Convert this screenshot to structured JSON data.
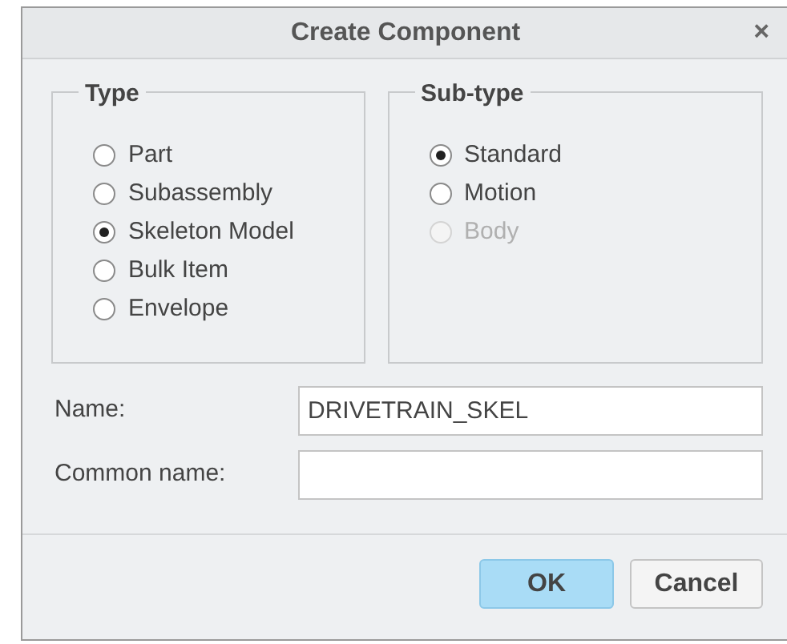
{
  "window": {
    "title": "Create Component",
    "close": "×"
  },
  "type_group": {
    "title": "Type",
    "options": [
      {
        "label": "Part",
        "selected": false,
        "disabled": false
      },
      {
        "label": "Subassembly",
        "selected": false,
        "disabled": false
      },
      {
        "label": "Skeleton Model",
        "selected": true,
        "disabled": false
      },
      {
        "label": "Bulk Item",
        "selected": false,
        "disabled": false
      },
      {
        "label": "Envelope",
        "selected": false,
        "disabled": false
      }
    ]
  },
  "subtype_group": {
    "title": "Sub-type",
    "options": [
      {
        "label": "Standard",
        "selected": true,
        "disabled": false
      },
      {
        "label": "Motion",
        "selected": false,
        "disabled": false
      },
      {
        "label": "Body",
        "selected": false,
        "disabled": true
      }
    ]
  },
  "fields": [
    {
      "label": "Name:",
      "value": "DRIVETRAIN_SKEL"
    },
    {
      "label": "Common name:"
    }
  ],
  "buttons": [
    {
      "label": "OK",
      "kind": "primary"
    },
    {
      "label": "Cancel",
      "kind": "secondary"
    }
  ]
}
